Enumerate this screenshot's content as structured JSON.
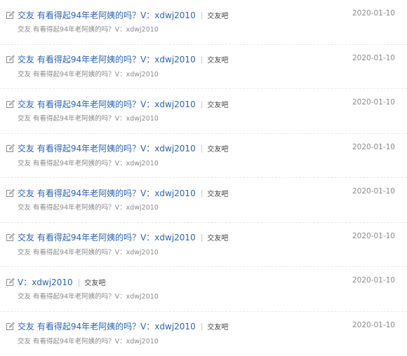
{
  "posts": [
    {
      "title": "交友 有看得起94年老阿姨的吗？V：xdwj2010",
      "separator": "|",
      "forum": "交友吧",
      "snippet": "交友 有看得起94年老阿姨的吗？V：xdwj2010",
      "date": "2020-01-10",
      "icon": "edit-icon"
    },
    {
      "title": "交友 有看得起94年老阿姨的吗？V：xdwj2010",
      "separator": "|",
      "forum": "交友吧",
      "snippet": "交友 有看得起94年老阿姨的吗？V：xdwj2010",
      "date": "2020-01-10",
      "icon": "edit-icon"
    },
    {
      "title": "交友 有看得起94年老阿姨的吗？V：xdwj2010",
      "separator": "|",
      "forum": "交友吧",
      "snippet": "交友 有看得起94年老阿姨的吗？V：xdwj2010",
      "date": "2020-01-10",
      "icon": "edit-icon"
    },
    {
      "title": "交友 有看得起94年老阿姨的吗？V：xdwj2010",
      "separator": "|",
      "forum": "交友吧",
      "snippet": "交友 有看得起94年老阿姨的吗？V：xdwj2010",
      "date": "2020-01-10",
      "icon": "edit-icon"
    },
    {
      "title": "交友 有看得起94年老阿姨的吗？V：xdwj2010",
      "separator": "|",
      "forum": "交友吧",
      "snippet": "交友 有看得起94年老阿姨的吗？V：xdwj2010",
      "date": "2020-01-10",
      "icon": "edit-icon"
    },
    {
      "title": "交友 有看得起94年老阿姨的吗？V：xdwj2010",
      "separator": "|",
      "forum": "交友吧",
      "snippet": "交友 有看得起94年老阿姨的吗？V：xdwj2010",
      "date": "2020-01-10",
      "icon": "edit-icon"
    },
    {
      "title": "V：xdwj2010",
      "separator": "|",
      "forum": "交友吧",
      "snippet": "交友 有看得起94年老阿姨的吗？V：xdwj2010",
      "date": "2020-01-10",
      "icon": "edit-icon"
    },
    {
      "title": "交友 有看得起94年老阿姨的吗？V：xdwj2010",
      "separator": "|",
      "forum": "交友吧",
      "snippet": "交友 有看得起94年老阿姨的吗？V：xdwj2010",
      "date": "2020-01-10",
      "icon": "edit-icon"
    }
  ],
  "colors": {
    "title_link": "#2d64b3",
    "meta_text": "#8a8a8a",
    "forum_text": "#444444",
    "separator": "#c6c6c6",
    "icon": "#8c8c8c"
  }
}
